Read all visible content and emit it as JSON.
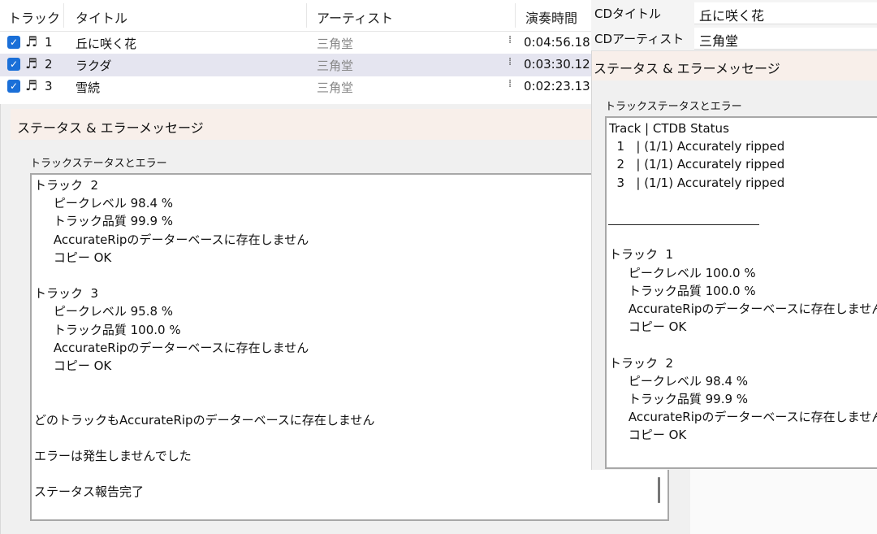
{
  "tracklist": {
    "columns": [
      "トラック",
      "タイトル",
      "アーティスト",
      "演奏時間"
    ],
    "rows": [
      {
        "num": "1",
        "title": "丘に咲く花",
        "artist": "三角堂",
        "duration": "0:04:56.18",
        "checked": true
      },
      {
        "num": "2",
        "title": "ラクダ",
        "artist": "三角堂",
        "duration": "0:03:30.12",
        "checked": true
      },
      {
        "num": "3",
        "title": "雪続",
        "artist": "三角堂",
        "duration": "0:02:23.13",
        "checked": true
      }
    ]
  },
  "cdinfo": {
    "title_label": "CDタイトル",
    "title_value": "丘に咲く花",
    "artist_label": "CDアーティスト",
    "artist_value": "三角堂"
  },
  "status_left": {
    "window_title": "ステータス & エラーメッセージ",
    "group_label": "トラックステータスとエラー",
    "lines": [
      "トラック  2",
      "     ピークレベル 98.4 %",
      "     トラック品質 99.9 %",
      "     AccurateRipのデーターベースに存在しません",
      "     コピー OK",
      "",
      "トラック  3",
      "     ピークレベル 95.8 %",
      "     トラック品質 100.0 %",
      "     AccurateRipのデーターベースに存在しません",
      "     コピー OK",
      "",
      "",
      "どのトラックもAccurateRipのデーターベースに存在しません",
      "",
      "エラーは発生しませんでした",
      "",
      "ステータス報告完了"
    ]
  },
  "status_right": {
    "window_title": "ステータス & エラーメッセージ",
    "group_label": "トラックステータスとエラー",
    "lines": [
      "Track | CTDB Status",
      "  1   | (1/1) Accurately ripped",
      "  2   | (1/1) Accurately ripped",
      "  3   | (1/1) Accurately ripped",
      "",
      "",
      "",
      "トラック  1",
      "     ピークレベル 100.0 %",
      "     トラック品質 100.0 %",
      "     AccurateRipのデーターベースに存在しません",
      "     コピー OK",
      "",
      "トラック  2",
      "     ピークレベル 98.4 %",
      "     トラック品質 99.9 %",
      "     AccurateRipのデーターベースに存在しません",
      "     コピー OK"
    ]
  }
}
